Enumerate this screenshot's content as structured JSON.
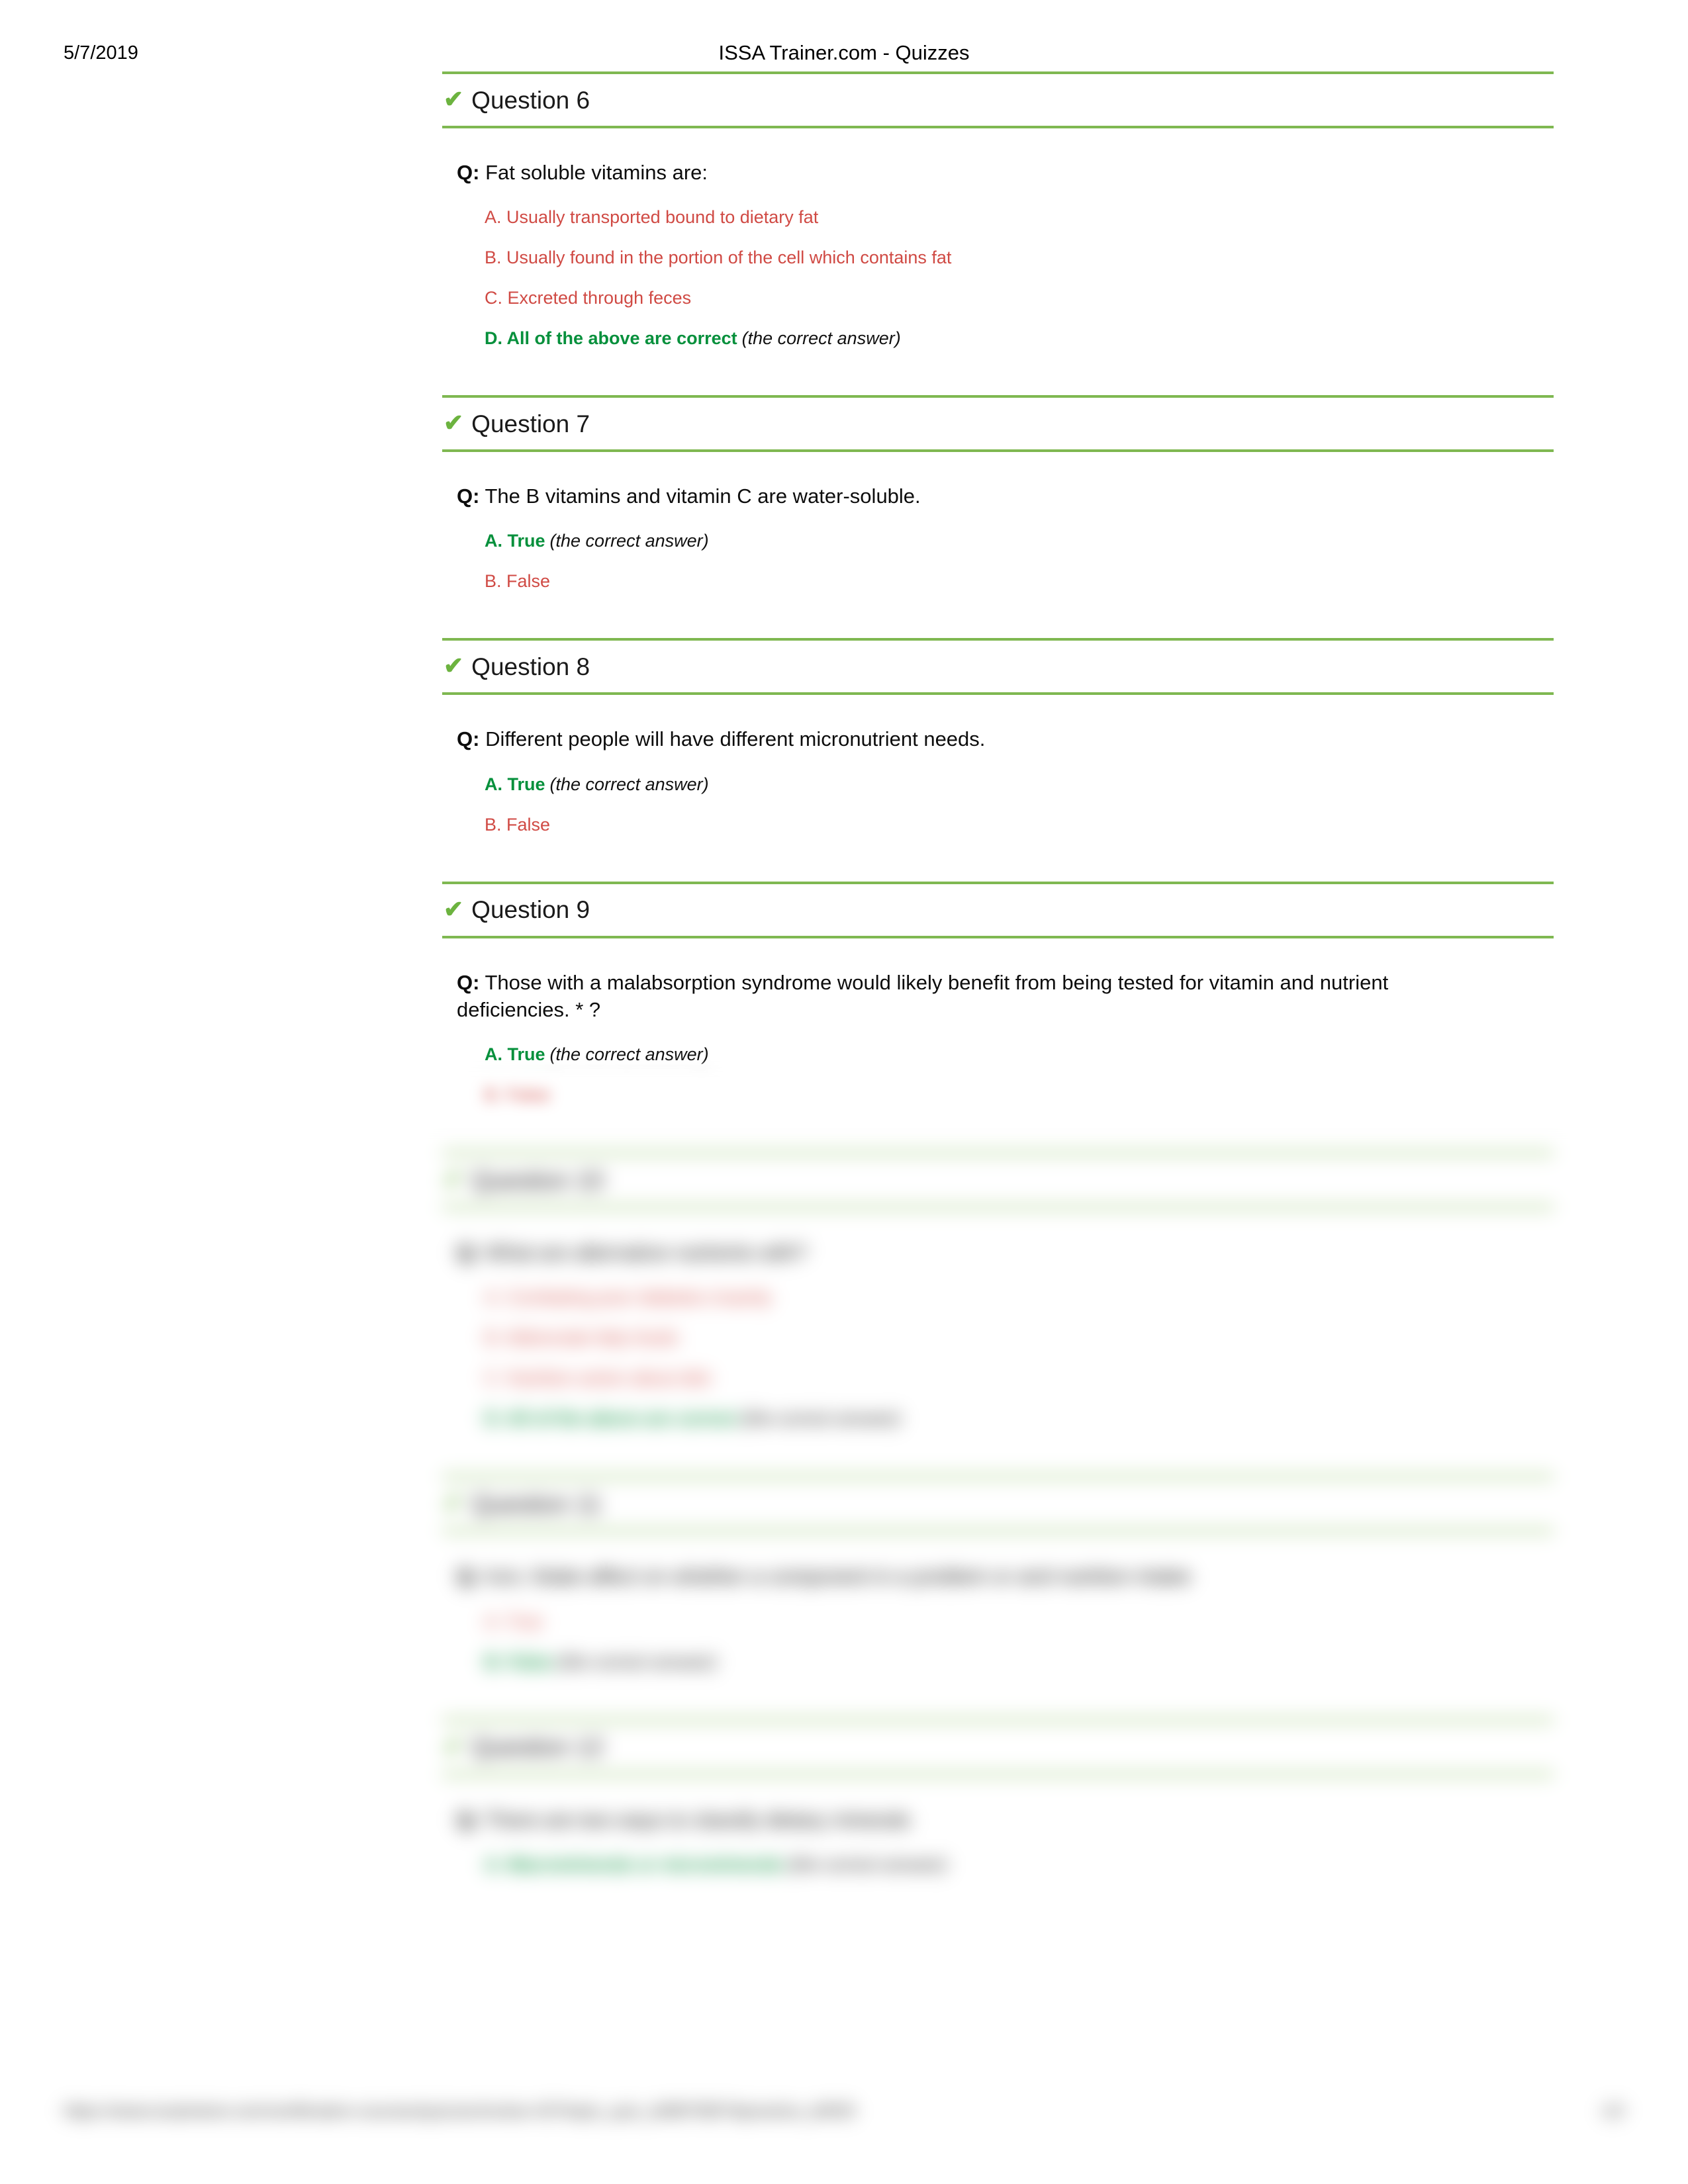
{
  "header": {
    "date": "5/7/2019",
    "title": "ISSA Trainer.com - Quizzes"
  },
  "colors": {
    "rule_green": "#7FB851",
    "check_green": "#6CB33F",
    "correct_green": "#06903C",
    "wrong_red": "#D04A44",
    "text_black": "#0d0d0d"
  },
  "icons": {
    "check": "✔"
  },
  "labels": {
    "q_prefix": "Q:",
    "correct_note": "(the correct answer)"
  },
  "questions": [
    {
      "id": "q6",
      "title": "Question 6",
      "prompt": "Fat soluble vitamins are:",
      "prompt_line2": "",
      "answers": [
        {
          "text": "A. Usually transported bound to dietary fat",
          "correct": false
        },
        {
          "text": "B. Usually found in the portion of the cell which contains fat",
          "correct": false
        },
        {
          "text": "C. Excreted through feces",
          "correct": false
        },
        {
          "text": "D. All of the above are correct",
          "correct": true
        }
      ]
    },
    {
      "id": "q7",
      "title": "Question 7",
      "prompt": "The B vitamins and vitamin C are water-soluble.",
      "prompt_line2": "",
      "answers": [
        {
          "text": "A. True",
          "correct": true
        },
        {
          "text": "B. False",
          "correct": false
        }
      ]
    },
    {
      "id": "q8",
      "title": "Question 8",
      "prompt": "Different people will have different micronutrient needs.",
      "prompt_line2": "",
      "answers": [
        {
          "text": "A. True",
          "correct": true
        },
        {
          "text": "B. False",
          "correct": false
        }
      ]
    },
    {
      "id": "q9",
      "title": "Question 9",
      "prompt": "Those with a malabsorption syndrome would likely benefit from being tested for vitamin and nutrient",
      "prompt_line2": "deficiencies. * ?",
      "answers": [
        {
          "text": "A. True",
          "correct": true
        },
        {
          "text": "B. False",
          "correct": false
        }
      ]
    },
    {
      "id": "q10",
      "title": "Question 10",
      "prompt": "What are alternative nutrients with?",
      "prompt_line2": "",
      "answers": [
        {
          "text": "A. Combating poor diabetes insanity",
          "correct": false
        },
        {
          "text": "B. Abbreviate fatty foods",
          "correct": false
        },
        {
          "text": "C. Nutrition action about diet",
          "correct": false
        },
        {
          "text": "D. All of the above are correct",
          "correct": true
        }
      ]
    },
    {
      "id": "q11",
      "title": "Question 11",
      "prompt": "Iron, folate affect on whether a component in a problem or and nutrition intake",
      "prompt_line2": "",
      "answers": [
        {
          "text": "A. True",
          "correct": false
        },
        {
          "text": "B. False",
          "correct": true
        }
      ]
    },
    {
      "id": "q12",
      "title": "Question 12",
      "prompt": "There are two ways to classify dietary minerals",
      "prompt_line2": "",
      "answers": [
        {
          "text": "A. Macrominerals or microminerals",
          "correct": true
        }
      ]
    }
  ],
  "footer": {
    "url": "https://www.issatrainer.com/certification-courses/quizzes/review-437/topic_quiz_id/887585?&practice_id/925",
    "page": "1/2"
  }
}
